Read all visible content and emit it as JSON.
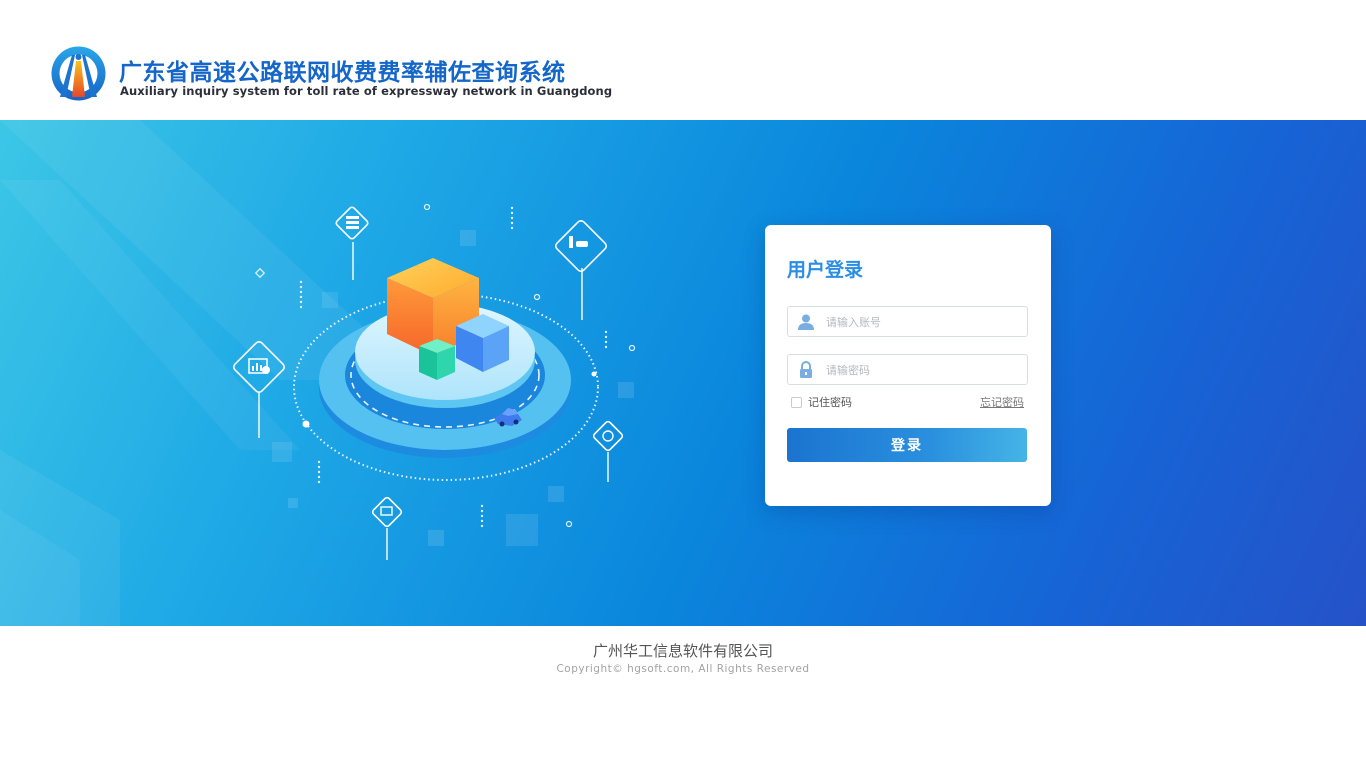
{
  "header": {
    "title_cn": "广东省高速公路联网收费费率辅佐查询系统",
    "title_en": "Auxiliary inquiry system for toll rate of expressway network in Guangdong",
    "logo_icon": "highway-logo-icon"
  },
  "login": {
    "title": "用户登录",
    "username_placeholder": "请输入账号",
    "password_placeholder": "请输密码",
    "remember_label": "记住密码",
    "forgot_label": "忘记密码",
    "submit_label": "登录",
    "user_icon": "user-icon",
    "lock_icon": "lock-icon"
  },
  "footer": {
    "company": "广州华工信息软件有限公司",
    "copyright": "Copyright© hgsoft.com, All Rights Reserved"
  },
  "colors": {
    "brand_blue": "#1466c8",
    "title_blue": "#2a8ee6",
    "button_start": "#1b74d0",
    "button_end": "#45b4e6",
    "banner_start": "#3cc6e6",
    "banner_end": "#2652c8"
  }
}
